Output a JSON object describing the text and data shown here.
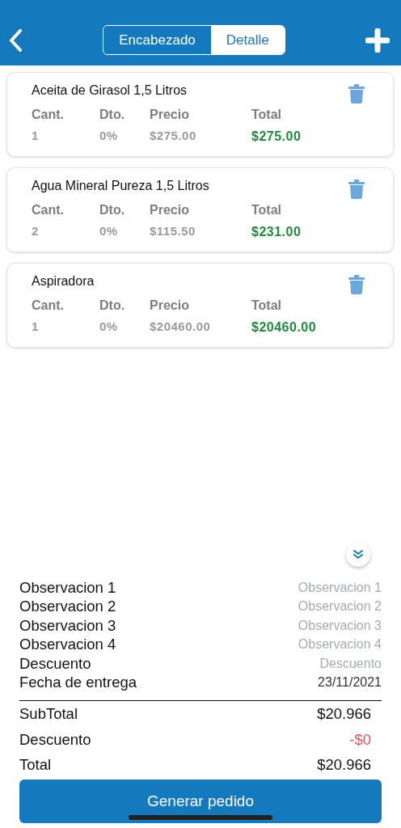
{
  "header": {
    "tabs": [
      {
        "label": "Encabezado",
        "selected": false
      },
      {
        "label": "Detalle",
        "selected": true
      }
    ]
  },
  "items": [
    {
      "name": "Aceita de Girasol 1,5 Litros",
      "columns": [
        "Cant.",
        "Dto.",
        "Precio",
        "Total"
      ],
      "values": [
        "1",
        "0%",
        "$275.00",
        "$275.00"
      ]
    },
    {
      "name": "Agua Mineral Pureza 1,5 Litros",
      "columns": [
        "Cant.",
        "Dto.",
        "Precio",
        "Total"
      ],
      "values": [
        "2",
        "0%",
        "$115.50",
        "$231.00"
      ]
    },
    {
      "name": "Aspiradora",
      "columns": [
        "Cant.",
        "Dto.",
        "Precio",
        "Total"
      ],
      "values": [
        "1",
        "0%",
        "$20460.00",
        "$20460.00"
      ]
    }
  ],
  "fields": [
    {
      "label": "Observacion 1",
      "placeholder": "Observacion 1"
    },
    {
      "label": "Observacion 2",
      "placeholder": "Observacion 2"
    },
    {
      "label": "Observacion 3",
      "placeholder": "Observacion 3"
    },
    {
      "label": "Observacion 4",
      "placeholder": "Observacion 4"
    },
    {
      "label": "Descuento",
      "placeholder": "Descuento"
    },
    {
      "label": "Fecha de entrega",
      "value": "23/11/2021"
    }
  ],
  "totals": [
    {
      "label": "SubTotal",
      "value": "$20.966",
      "kind": "plain"
    },
    {
      "label": "Descuento",
      "value": "-$0",
      "kind": "negative"
    },
    {
      "label": "Total",
      "value": "$20.966",
      "kind": "plain"
    }
  ],
  "submit_button": "Generar pedido"
}
